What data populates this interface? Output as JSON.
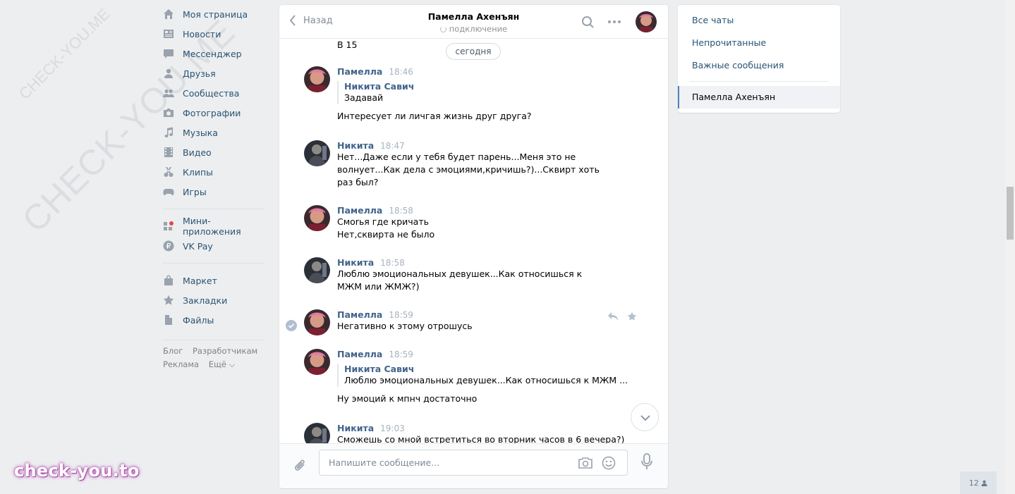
{
  "watermark": {
    "big": "CHECK-YOU.ME",
    "small": "CHECK-YOU.ME",
    "badge": "check-you.to"
  },
  "nav": {
    "items": [
      {
        "label": "Моя страница",
        "icon": "home-icon"
      },
      {
        "label": "Новости",
        "icon": "news-icon"
      },
      {
        "label": "Мессенджер",
        "icon": "messenger-icon"
      },
      {
        "label": "Друзья",
        "icon": "friends-icon"
      },
      {
        "label": "Сообщества",
        "icon": "groups-icon"
      },
      {
        "label": "Фотографии",
        "icon": "camera-icon"
      },
      {
        "label": "Музыка",
        "icon": "music-icon"
      },
      {
        "label": "Видео",
        "icon": "video-icon"
      },
      {
        "label": "Клипы",
        "icon": "clips-icon"
      },
      {
        "label": "Игры",
        "icon": "games-icon"
      }
    ],
    "items2": [
      {
        "label": "Мини-приложения",
        "icon": "apps-icon"
      },
      {
        "label": "VK Pay",
        "icon": "vkpay-icon"
      }
    ],
    "items3": [
      {
        "label": "Маркет",
        "icon": "market-icon"
      },
      {
        "label": "Закладки",
        "icon": "star-icon"
      },
      {
        "label": "Файлы",
        "icon": "file-icon"
      }
    ],
    "footer": {
      "blog": "Блог",
      "dev": "Разработчикам",
      "ads": "Реклама",
      "more": "Ещё ⌵"
    }
  },
  "header": {
    "back_label": "Назад",
    "title": "Памелла Ахенъян",
    "status": "подключение"
  },
  "history": {
    "top_text": "В 15",
    "date_label": "сегодня",
    "messages": [
      {
        "author": "Памелла",
        "time": "18:46",
        "quote_author": "Никита Савич",
        "quote_text": "Задавай",
        "text": "Интересует ли личгая жизнь друг друга?"
      },
      {
        "author": "Никита",
        "time": "18:47",
        "text": "Нет...Даже если у тебя будет парень...Меня это не волнует...Как дела с эмоциями,кричишь?)...Сквирт хоть раз был?"
      },
      {
        "author": "Памелла",
        "time": "18:58",
        "text": "Смоrья где кричать\nНет,сквирта не было"
      },
      {
        "author": "Никита",
        "time": "18:58",
        "text": "Люблю эмоциональных девушек...Как относишься к МЖМ или ЖМЖ?)"
      },
      {
        "author": "Памелла",
        "time": "18:59",
        "text": "Негативно к этому отрошусь"
      },
      {
        "author": "Памелла",
        "time": "18:59",
        "quote_author": "Никита Савич",
        "quote_text": "Люблю эмоциональных девушек...Как относишься к МЖМ ...",
        "text": "Ну эмоций к мпнч достаточно"
      },
      {
        "author": "Никита",
        "time": "19:03",
        "text": "Сможешь со мной встретиться во вторник часов в 6 вечера?)"
      }
    ]
  },
  "composer": {
    "placeholder": "Напишите сообщение..."
  },
  "right": {
    "all": "Все чаты",
    "unread": "Непрочитанные",
    "important": "Важные сообщения",
    "active_chat": "Памелла Ахенъян"
  },
  "counter": "12"
}
